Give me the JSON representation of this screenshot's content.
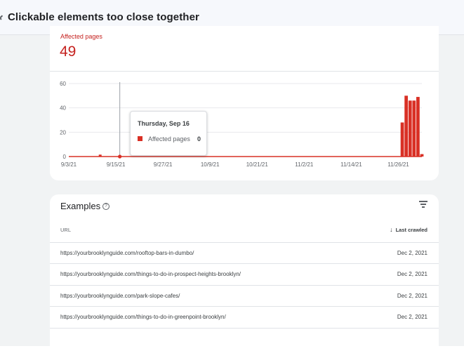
{
  "header": {
    "title": "Clickable elements too close together"
  },
  "metric": {
    "label": "Affected pages",
    "value": "49"
  },
  "tooltip": {
    "date": "Thursday, Sep 16",
    "series_label": "Affected pages",
    "value": "0"
  },
  "colors": {
    "accent": "#d93025",
    "gridline": "#e8eaed"
  },
  "chart_data": {
    "type": "bar",
    "y_ticks": [
      "0",
      "20",
      "40",
      "60"
    ],
    "ylim": [
      0,
      60
    ],
    "x_ticks": [
      "9/3/21",
      "9/15/21",
      "9/27/21",
      "10/9/21",
      "10/21/21",
      "11/2/21",
      "11/14/21",
      "11/26/21"
    ],
    "xlabel": "",
    "ylabel": "",
    "series": [
      {
        "name": "Affected pages",
        "days": [
          "11/27/21",
          "11/28/21",
          "11/29/21",
          "11/30/21",
          "12/1/21",
          "12/2/21"
        ],
        "values": [
          28,
          50,
          46,
          46,
          49,
          2
        ],
        "baseline_days": [
          "9/3/21",
          "12/2/21"
        ],
        "small_spike": {
          "day": "9/11/21",
          "value": 1
        },
        "hover_point": {
          "day": "9/16/21",
          "value": 0
        }
      }
    ],
    "grid": true
  },
  "examples": {
    "title": "Examples",
    "help_glyph": "?",
    "sort_arrow": "↓",
    "columns": {
      "url": "URL",
      "last_crawled": "Last crawled"
    },
    "rows": [
      {
        "url": "https://yourbrooklynguide.com/rooftop-bars-in-dumbo/",
        "date": "Dec 2, 2021"
      },
      {
        "url": "https://yourbrooklynguide.com/things-to-do-in-prospect-heights-brooklyn/",
        "date": "Dec 2, 2021"
      },
      {
        "url": "https://yourbrooklynguide.com/park-slope-cafes/",
        "date": "Dec 2, 2021"
      },
      {
        "url": "https://yourbrooklynguide.com/things-to-do-in-greenpoint-brooklyn/",
        "date": "Dec 2, 2021"
      }
    ]
  }
}
